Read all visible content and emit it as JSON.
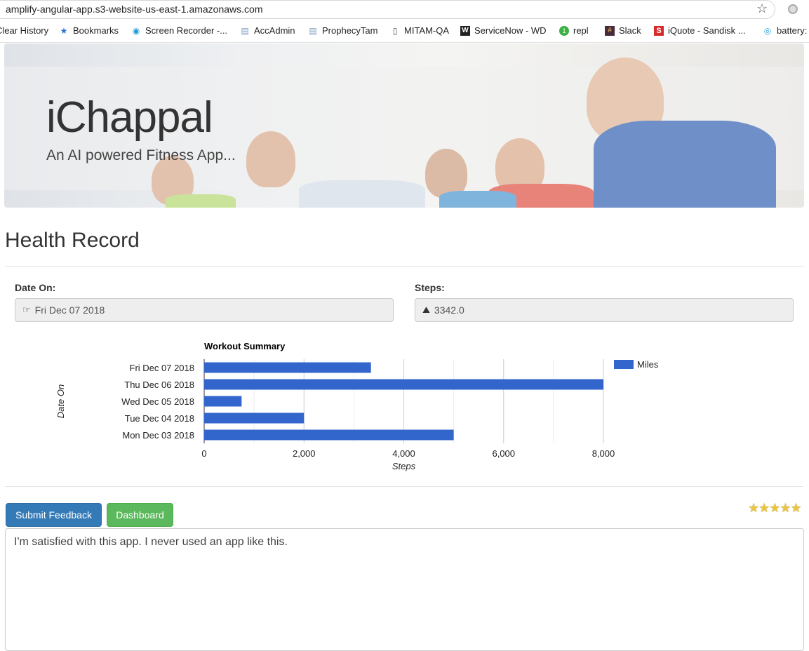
{
  "browser": {
    "url": "amplify-angular-app.s3-website-us-east-1.amazonaws.com",
    "bookmarks": [
      {
        "label": "Clear History",
        "icon": "none"
      },
      {
        "label": "Bookmarks",
        "icon": "star-icon"
      },
      {
        "label": "Screen Recorder -...",
        "icon": "recorder-icon"
      },
      {
        "label": "AccAdmin",
        "icon": "page-icon"
      },
      {
        "label": "ProphecyTam",
        "icon": "page-icon"
      },
      {
        "label": "MITAM-QA",
        "icon": "document-icon"
      },
      {
        "label": "ServiceNow - WD",
        "icon": "servicenow-icon"
      },
      {
        "label": "repl",
        "icon": "repl-icon"
      },
      {
        "label": "Slack",
        "icon": "slack-icon"
      },
      {
        "label": "iQuote - Sandisk ...",
        "icon": "iquote-icon"
      },
      {
        "label": "battery:",
        "icon": "battery-icon"
      }
    ]
  },
  "hero": {
    "title": "iChappal",
    "subtitle": "An AI powered Fitness App..."
  },
  "page": {
    "title": "Health Record"
  },
  "form": {
    "date_label": "Date On:",
    "date_value": "Fri Dec 07 2018",
    "date_icon": "hand-point-right-icon",
    "steps_label": "Steps:",
    "steps_value": "3342.0",
    "steps_icon": "road-icon"
  },
  "chart_data": {
    "type": "bar",
    "orientation": "horizontal",
    "title": "Workout Summary",
    "xlabel": "Steps",
    "ylabel": "Date On",
    "categories": [
      "Fri Dec 07 2018",
      "Thu Dec 06 2018",
      "Wed Dec 05 2018",
      "Tue Dec 04 2018",
      "Mon Dec 03 2018"
    ],
    "series": [
      {
        "name": "Miles",
        "values": [
          3342,
          8000,
          750,
          2000,
          5000
        ],
        "color": "#3366cc"
      }
    ],
    "xlim": [
      0,
      8000
    ],
    "xticks": [
      "0",
      "2,000",
      "4,000",
      "6,000",
      "8,000"
    ],
    "grid": true,
    "legend": "top-right"
  },
  "actions": {
    "submit_label": "Submit Feedback",
    "dashboard_label": "Dashboard",
    "rating": 5,
    "rating_stars": "★★★★★"
  },
  "feedback": {
    "text": "I'm satisfied with this app. I never used an app like this."
  }
}
